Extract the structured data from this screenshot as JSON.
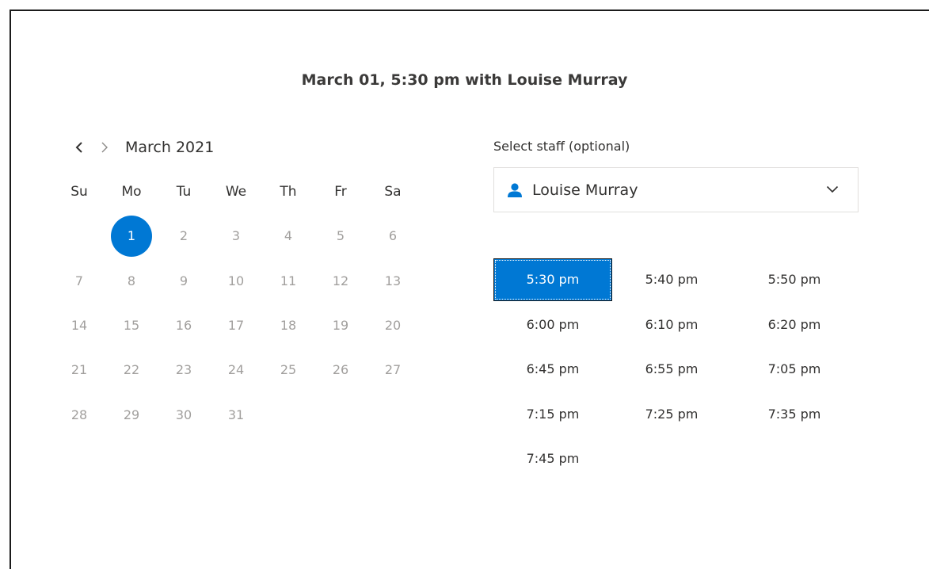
{
  "booking": {
    "headline": "March 01, 5:30 pm with Louise Murray"
  },
  "calendar": {
    "month_label": "March 2021",
    "prev_icon": "chevron-left-icon",
    "next_icon": "chevron-right-icon",
    "weekdays": [
      "Su",
      "Mo",
      "Tu",
      "We",
      "Th",
      "Fr",
      "Sa"
    ],
    "weeks": [
      [
        "",
        "1",
        "2",
        "3",
        "4",
        "5",
        "6"
      ],
      [
        "7",
        "8",
        "9",
        "10",
        "11",
        "12",
        "13"
      ],
      [
        "14",
        "15",
        "16",
        "17",
        "18",
        "19",
        "20"
      ],
      [
        "21",
        "22",
        "23",
        "24",
        "25",
        "26",
        "27"
      ],
      [
        "28",
        "29",
        "30",
        "31",
        "",
        "",
        ""
      ]
    ],
    "selected_day": "1",
    "selected_color": "#0078d4",
    "unavailable_color": "#a19f9d"
  },
  "staff": {
    "label": "Select staff (optional)",
    "selected": "Louise Murray",
    "person_icon": "person-icon",
    "dropdown_icon": "chevron-down-icon"
  },
  "times": {
    "slots": [
      "5:30 pm",
      "5:40 pm",
      "5:50 pm",
      "6:00 pm",
      "6:10 pm",
      "6:20 pm",
      "6:45 pm",
      "6:55 pm",
      "7:05 pm",
      "7:15 pm",
      "7:25 pm",
      "7:35 pm",
      "7:45 pm"
    ],
    "selected": "5:30 pm"
  }
}
